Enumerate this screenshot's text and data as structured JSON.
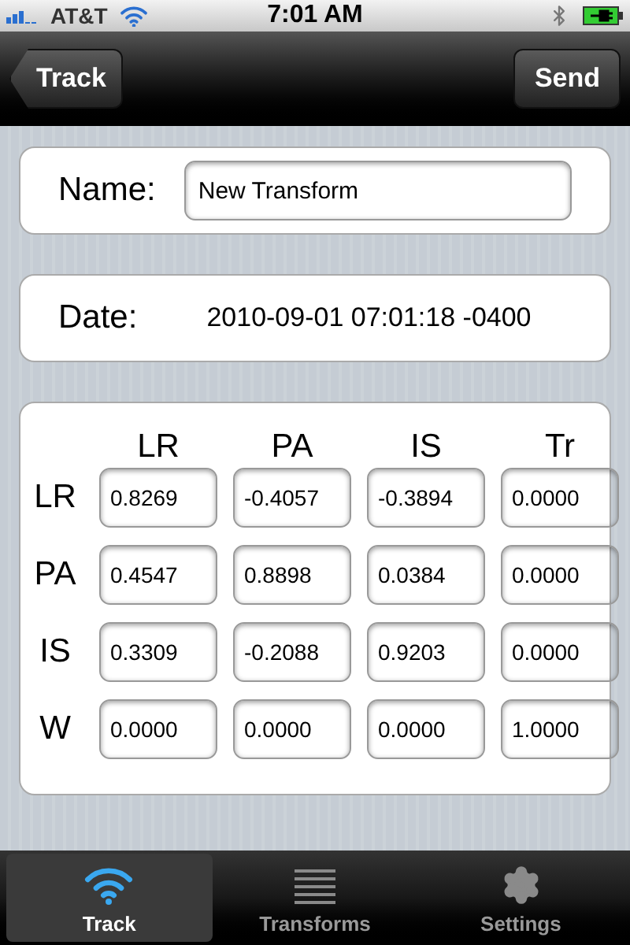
{
  "status_bar": {
    "carrier": "AT&T",
    "time": "7:01 AM"
  },
  "nav_bar": {
    "back_button": "Track",
    "action_button": "Send"
  },
  "name_field": {
    "label": "Name:",
    "value": "New Transform"
  },
  "date_row": {
    "label": "Date:",
    "value": "2010-09-01 07:01:18 -0400"
  },
  "matrix": {
    "columns": [
      "LR",
      "PA",
      "IS",
      "Tr"
    ],
    "rows": [
      {
        "label": "LR",
        "values": [
          "0.8269",
          "-0.4057",
          "-0.3894",
          "0.0000"
        ]
      },
      {
        "label": "PA",
        "values": [
          "0.4547",
          "0.8898",
          "0.0384",
          "0.0000"
        ]
      },
      {
        "label": "IS",
        "values": [
          "0.3309",
          "-0.2088",
          "0.9203",
          "0.0000"
        ]
      },
      {
        "label": "W",
        "values": [
          "0.0000",
          "0.0000",
          "0.0000",
          "1.0000"
        ]
      }
    ]
  },
  "tab_bar": [
    {
      "label": "Track",
      "kind": "wifi",
      "selected": true
    },
    {
      "label": "Transforms",
      "kind": "list",
      "selected": false
    },
    {
      "label": "Settings",
      "kind": "gear",
      "selected": false
    }
  ]
}
